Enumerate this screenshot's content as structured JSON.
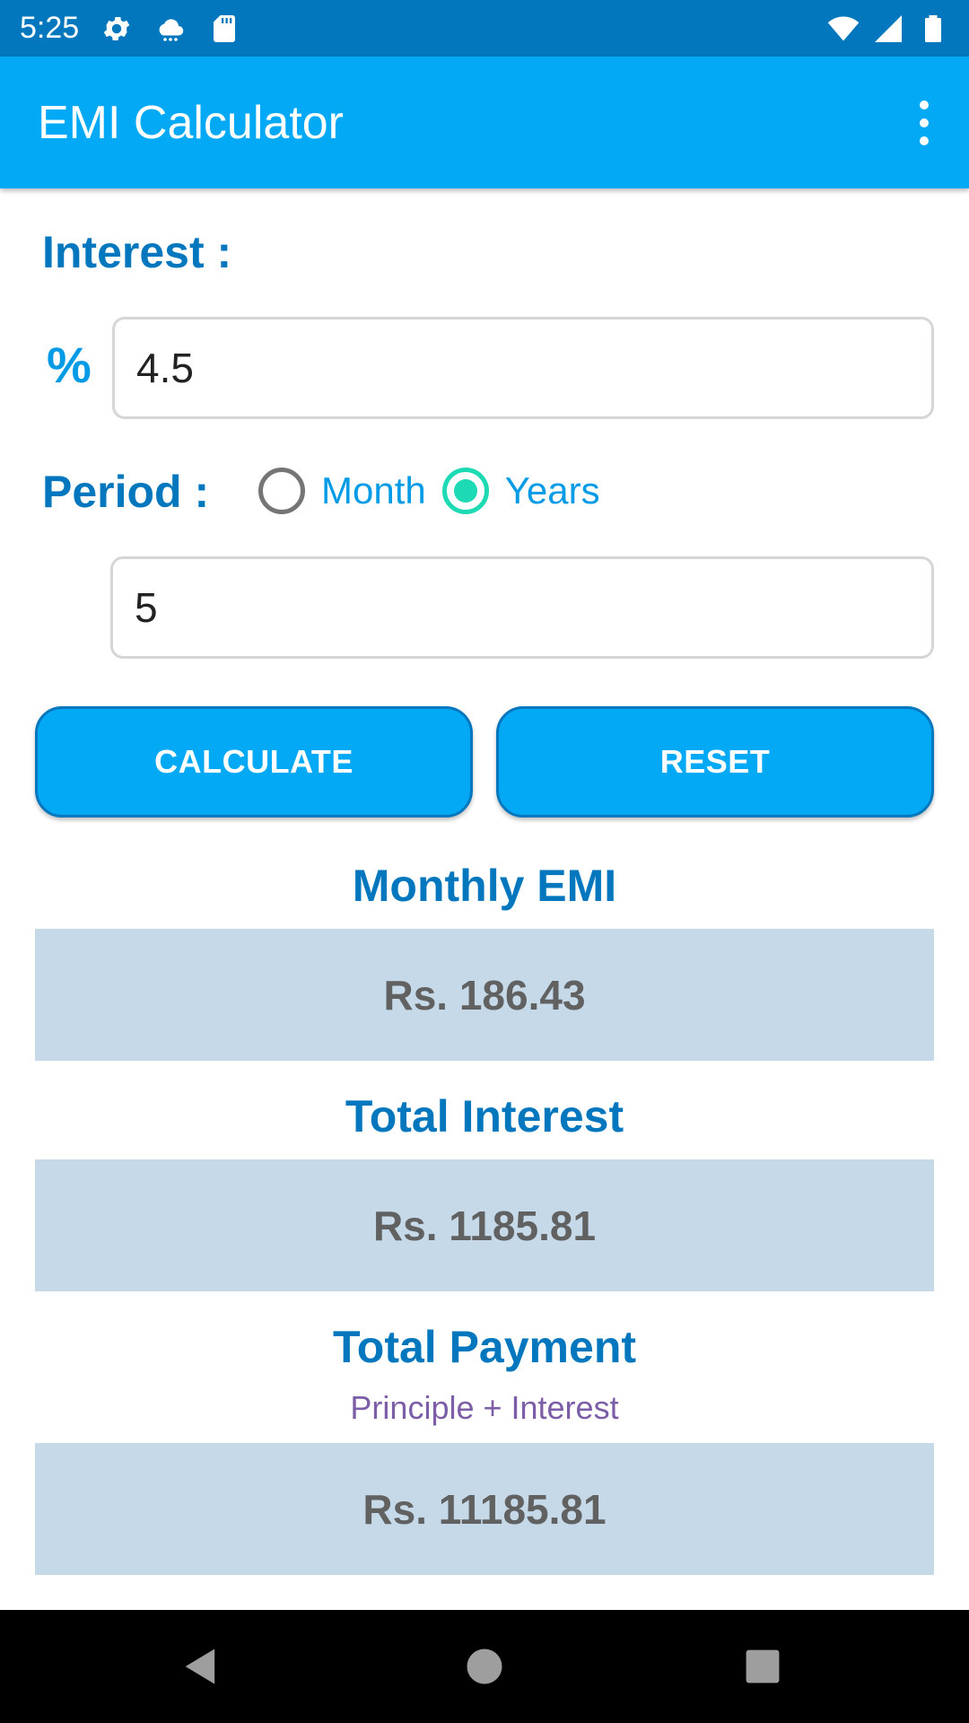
{
  "status_bar": {
    "time": "5:25",
    "left_icons": [
      "settings-icon",
      "cloud-icon",
      "sd-card-icon"
    ],
    "right_icons": [
      "wifi-icon",
      "signal-icon",
      "battery-icon"
    ]
  },
  "app_bar": {
    "title": "EMI Calculator",
    "menu_icon": "more-vert-icon"
  },
  "interest": {
    "label": "Interest :",
    "symbol": "%",
    "value": "4.5"
  },
  "period": {
    "label": "Period :",
    "options": [
      {
        "label": "Month",
        "checked": false
      },
      {
        "label": "Years",
        "checked": true
      }
    ],
    "value": "5"
  },
  "buttons": {
    "calculate": "CALCULATE",
    "reset": "RESET"
  },
  "results": {
    "monthly_emi": {
      "title": "Monthly EMI",
      "value": "Rs. 186.43"
    },
    "total_interest": {
      "title": "Total Interest",
      "value": "Rs. 1185.81"
    },
    "total_payment": {
      "title": "Total Payment",
      "subtitle": "Principle + Interest",
      "value": "Rs. 11185.81"
    }
  },
  "nav_bar": {
    "icons": [
      "back-icon",
      "home-icon",
      "recents-icon"
    ]
  },
  "colors": {
    "status_bar": "#0277bd",
    "app_bar": "#03a9f4",
    "label_blue": "#0277bd",
    "radio_checked": "#1dd9b4",
    "result_bg": "#c5d9e8",
    "subtitle_purple": "#7b5ea7"
  }
}
